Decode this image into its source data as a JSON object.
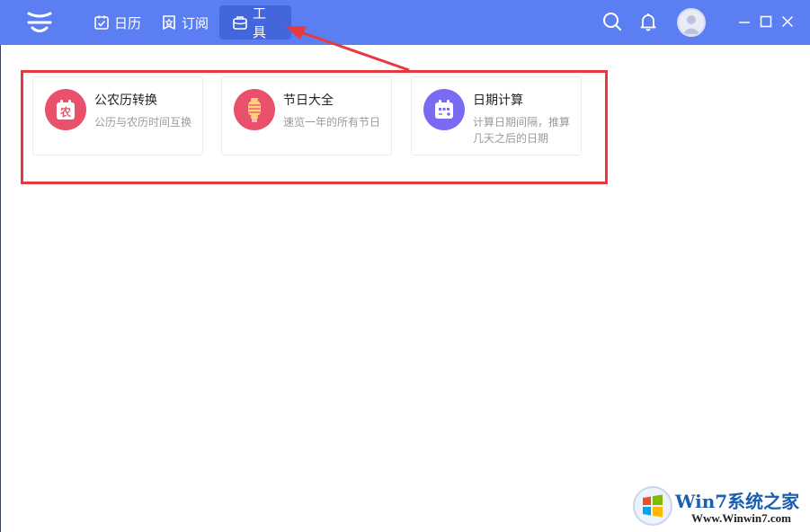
{
  "header": {
    "logo_icon": "app-logo-icon",
    "nav": [
      {
        "label": "日历",
        "icon": "calendar-check-icon",
        "active": false
      },
      {
        "label": "订阅",
        "icon": "star-bookmark-icon",
        "active": false
      },
      {
        "label": "工具",
        "icon": "toolbox-icon",
        "active": true
      }
    ],
    "actions": [
      "search-icon",
      "bell-icon",
      "avatar"
    ],
    "window_controls": [
      "minimize-icon",
      "maximize-icon",
      "close-icon"
    ],
    "bg_color": "#5b7ef3",
    "active_color": "#4466dd"
  },
  "tools": [
    {
      "title": "公农历转换",
      "desc": "公历与农历时间互换",
      "icon": "lunar-calendar-icon",
      "icon_glyph": "农",
      "color": "#e8506b"
    },
    {
      "title": "节日大全",
      "desc": "速览一年的所有节日",
      "icon": "lantern-icon",
      "color": "#e8506b"
    },
    {
      "title": "日期计算",
      "desc": "计算日期间隔，推算几天之后的日期",
      "icon": "date-calculator-icon",
      "color": "#7a6cf2"
    }
  ],
  "annotation": {
    "color": "#e53a3f"
  },
  "watermark": {
    "title": "Win7系统之家",
    "url": "Www.Winwin7.com"
  }
}
